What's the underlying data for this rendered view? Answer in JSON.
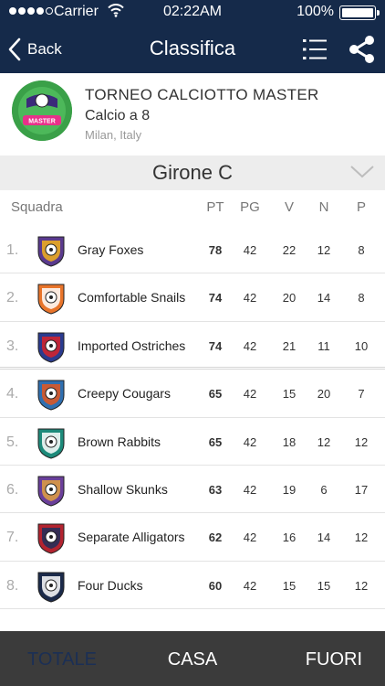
{
  "status_bar": {
    "carrier": "Carrier",
    "time": "02:22AM",
    "battery": "100%",
    "signal_bars": 5,
    "signal_filled": 4
  },
  "nav": {
    "back_label": "Back",
    "title": "Classifica"
  },
  "tournament": {
    "name": "TORNEO CALCIOTTO MASTER",
    "sport": "Calcio a 8",
    "location": "Milan, Italy",
    "logo_text": "MASTER"
  },
  "group": {
    "label": "Girone C"
  },
  "columns": {
    "team": "Squadra",
    "pt": "PT",
    "pg": "PG",
    "v": "V",
    "n": "N",
    "p": "P"
  },
  "standings": [
    {
      "pos": "1.",
      "team": "Gray Foxes",
      "pt": "78",
      "pg": "42",
      "v": "22",
      "n": "12",
      "p": "8",
      "crest_color": "#5a3a8e",
      "crest_accent": "#f2b21c"
    },
    {
      "pos": "2.",
      "team": "Comfortable Snails",
      "pt": "74",
      "pg": "42",
      "v": "20",
      "n": "14",
      "p": "8",
      "crest_color": "#e8742a",
      "crest_accent": "#ffffff"
    },
    {
      "pos": "3.",
      "team": "Imported Ostriches",
      "pt": "74",
      "pg": "42",
      "v": "21",
      "n": "11",
      "p": "10",
      "crest_color": "#2a3b8f",
      "crest_accent": "#d8232a"
    },
    {
      "pos": "4.",
      "team": "Creepy Cougars",
      "pt": "65",
      "pg": "42",
      "v": "15",
      "n": "20",
      "p": "7",
      "crest_color": "#2f6fb0",
      "crest_accent": "#e4571f"
    },
    {
      "pos": "5.",
      "team": "Brown Rabbits",
      "pt": "65",
      "pg": "42",
      "v": "18",
      "n": "12",
      "p": "12",
      "crest_color": "#1d8a7a",
      "crest_accent": "#ffffff"
    },
    {
      "pos": "6.",
      "team": "Shallow Skunks",
      "pt": "63",
      "pg": "42",
      "v": "19",
      "n": "6",
      "p": "17",
      "crest_color": "#6a3f9a",
      "crest_accent": "#e0a040"
    },
    {
      "pos": "7.",
      "team": "Separate Alligators",
      "pt": "62",
      "pg": "42",
      "v": "16",
      "n": "14",
      "p": "12",
      "crest_color": "#b3232f",
      "crest_accent": "#1f2f5a"
    },
    {
      "pos": "8.",
      "team": "Four Ducks",
      "pt": "60",
      "pg": "42",
      "v": "15",
      "n": "15",
      "p": "12",
      "crest_color": "#1b2a4a",
      "crest_accent": "#ffffff"
    }
  ],
  "tabs": {
    "totale": "TOTALE",
    "casa": "CASA",
    "fuori": "FUORI",
    "active": "totale"
  },
  "colors": {
    "nav_bg": "#152a4a",
    "tabbar_bg": "#3b3b3b",
    "active_tab": "#1b2f55"
  }
}
